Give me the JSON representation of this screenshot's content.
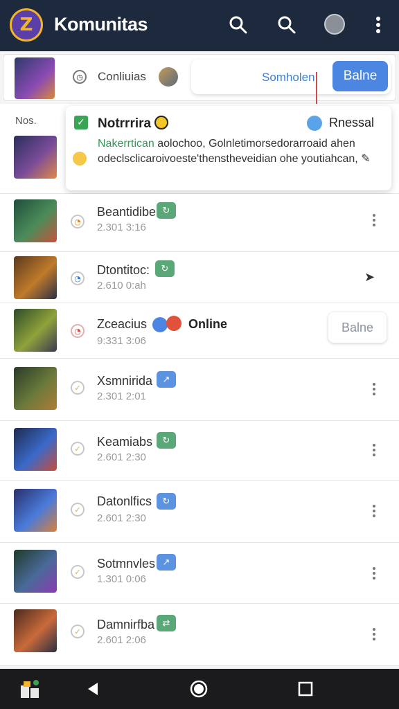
{
  "app": {
    "title": "Komunitas",
    "logo_letter": "Z"
  },
  "search": {
    "scope_label": "Conliuias",
    "placeholder": "Somholen",
    "button_label": "Balne"
  },
  "popup": {
    "side_label": "Nos.",
    "title": "Notrrrira",
    "right_label": "Rnessal",
    "highlight": "Nakerrtican",
    "body": " aolochoo, Golnletimorsedorarroaid ahen odeclsclicaroivoeste'thenstheveidian ohe youtiahcan,"
  },
  "rows": [
    {
      "name": "Beantidibe",
      "time": "2.301 3:16",
      "badge": "↻"
    },
    {
      "name": "Dtontitoc:",
      "time": "2.610 0:ah",
      "badge": "↻"
    },
    {
      "name": "Zceacius",
      "time": "9:331 3:06",
      "status": "Online",
      "action_label": "Balne"
    },
    {
      "name": "Xsmnirida",
      "time": "2.301 2:01",
      "badge": "↗"
    },
    {
      "name": "Keamiabs",
      "time": "2.601 2:30",
      "badge": "↻"
    },
    {
      "name": "Datonlfics",
      "time": "2.601 2:30",
      "badge": "↻"
    },
    {
      "name": "Sotmnvles",
      "time": "1.301 0:06",
      "badge": "↗"
    },
    {
      "name": "Damnirfba",
      "time": "2.601 2:06",
      "badge": "⇄"
    }
  ],
  "colors": {
    "appbar": "#1d2a3d",
    "accent": "#4a86e2",
    "online_green": "#2f9a55",
    "navbar": "#1b1b1d"
  }
}
